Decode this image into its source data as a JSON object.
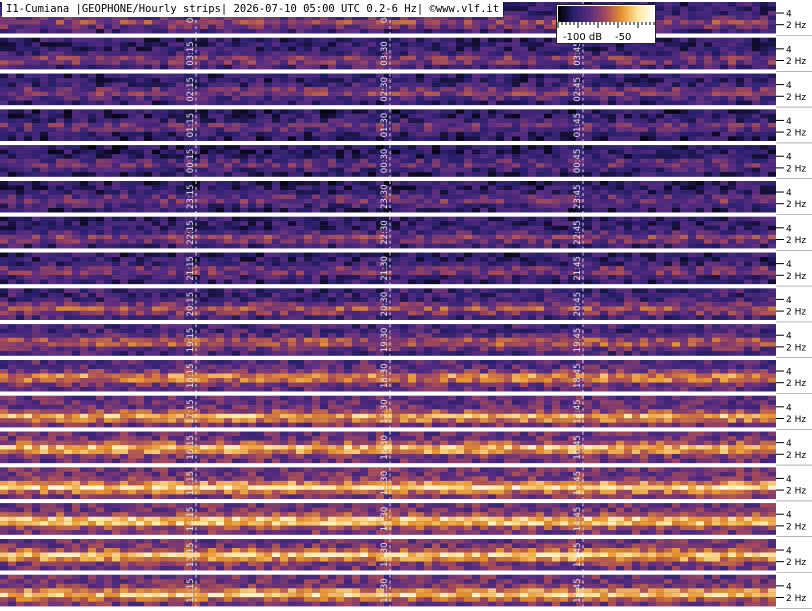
{
  "header": {
    "title": "I1-Cumiana |GEOPHONE/Hourly strips| 2026-07-10 05:00 UTC 0.2-6 Hz| ©www.vlf.it"
  },
  "legend": {
    "labels": [
      "-100 dB",
      "-50"
    ],
    "colors": [
      "#000000",
      "#2a1f6e",
      "#5a2d82",
      "#a54a5a",
      "#e8942e",
      "#ffe9a0",
      "#ffffff"
    ]
  },
  "chart_data": {
    "type": "heatmap",
    "title": "I1-Cumiana |GEOPHONE/Hourly strips| 2026-07-10 05:00 UTC 0.2-6 Hz| ©www.vlf.it",
    "xlabel": "",
    "ylabel": "",
    "frequency_range_hz": [
      0.2,
      6
    ],
    "y_ticks": [
      "4",
      "2 Hz"
    ],
    "colorbar": {
      "labels": [
        "-100 dB",
        "-50"
      ],
      "range_db": [
        -100,
        -50
      ]
    },
    "strips": [
      {
        "hour": "04",
        "markers": [
          "04",
          "04"
        ],
        "intensity": 0.38
      },
      {
        "hour": "03",
        "markers": [
          "03:15",
          "03:30",
          "03:45"
        ],
        "intensity": 0.36
      },
      {
        "hour": "02",
        "markers": [
          "02:15",
          "02:30",
          "02:45"
        ],
        "intensity": 0.36
      },
      {
        "hour": "01",
        "markers": [
          "01:15",
          "01:30",
          "01:45"
        ],
        "intensity": 0.3
      },
      {
        "hour": "00",
        "markers": [
          "00:15",
          "00:30",
          "00:45"
        ],
        "intensity": 0.3
      },
      {
        "hour": "23",
        "markers": [
          "23:15",
          "23:30",
          "23:45"
        ],
        "intensity": 0.32
      },
      {
        "hour": "22",
        "markers": [
          "22:15",
          "22:30",
          "22:45"
        ],
        "intensity": 0.36
      },
      {
        "hour": "21",
        "markers": [
          "21:15",
          "21:30",
          "21:45"
        ],
        "intensity": 0.34
      },
      {
        "hour": "20",
        "markers": [
          "20:15",
          "20:30",
          "20:45"
        ],
        "intensity": 0.42
      },
      {
        "hour": "19",
        "markers": [
          "19:15",
          "19:30",
          "19:45"
        ],
        "intensity": 0.46
      },
      {
        "hour": "18",
        "markers": [
          "18:15",
          "18:30",
          "18:45"
        ],
        "intensity": 0.55
      },
      {
        "hour": "17",
        "markers": [
          "17:15",
          "17:30",
          "17:45"
        ],
        "intensity": 0.6
      },
      {
        "hour": "16",
        "markers": [
          "16:15",
          "16:30",
          "16:45"
        ],
        "intensity": 0.64
      },
      {
        "hour": "15",
        "markers": [
          "15:15",
          "15:30",
          "15:45"
        ],
        "intensity": 0.68
      },
      {
        "hour": "14",
        "markers": [
          "14:15",
          "14:30",
          "14:45"
        ],
        "intensity": 0.68
      },
      {
        "hour": "13",
        "markers": [
          "13:15",
          "13:30",
          "13:45"
        ],
        "intensity": 0.66
      },
      {
        "hour": "12",
        "markers": [
          "12:15",
          "12:30",
          "12:45"
        ],
        "intensity": 0.66
      }
    ]
  }
}
